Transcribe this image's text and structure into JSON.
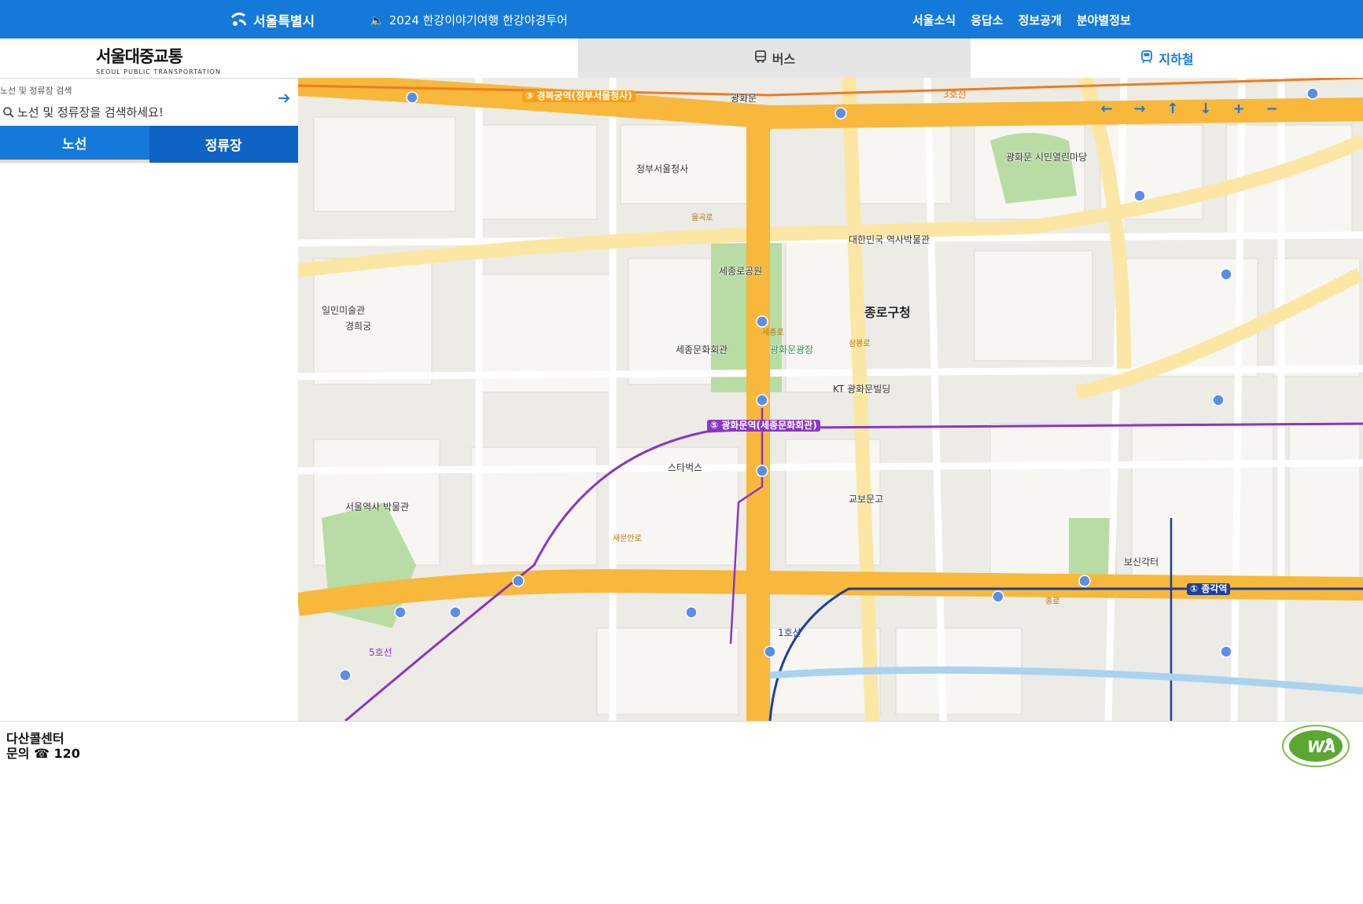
{
  "header": {
    "logo_text": "서울특별시",
    "notice": "2024 한강이야기여행 한강야경투어",
    "nav": [
      "서울소식",
      "응답소",
      "정보공개",
      "분야별정보"
    ]
  },
  "brand": {
    "title": "서울대중교통",
    "subtitle": "SEOUL PUBLIC TRANSPORTATION"
  },
  "mode_tabs": {
    "bus": "버스",
    "subway": "지하철"
  },
  "search": {
    "label": "노선 및 정류장 검색",
    "placeholder": "노선 및 정류장을 검색하세요!"
  },
  "sub_tabs": {
    "route": "노선",
    "stop": "정류장"
  },
  "map": {
    "labels": {
      "gwanghwamun": "광화문",
      "sejong_center": "세종문화회관",
      "jongno_office": "종로구청",
      "gyeongbokgung_stn": "③ 경복궁역(정부서울청사)",
      "gwanghwamun_stn": "⑤ 광화문역(세종문화회관)",
      "jonggak_stn": "① 종각역",
      "sejong_park": "세종로공원",
      "gwanghwamun_square": "광화문광장",
      "museum": "대한민국 역사박물관",
      "kt": "KT 광화문빌딩",
      "kyobo": "교보문고",
      "sejongno": "세종로",
      "saemunan": "새문안로",
      "samilro": "삼봉로",
      "gyeonghuigung": "경희궁",
      "seoul_museum": "서울역사 박물관",
      "starbucks": "스타벅스",
      "ilmin": "일민미술관",
      "bosingak": "보신각터",
      "citizen_yard": "광화문 시민열린마당",
      "jeongbu": "정부서울청사",
      "yulgok": "율곡로",
      "jongno": "종로",
      "line5": "5호선",
      "line3": "3호선",
      "line1": "1호선"
    }
  },
  "footer": {
    "dasan_title": "다산콜센터",
    "dasan_phone": "문의 ☎ 120",
    "wa_mark": "WA"
  },
  "colors": {
    "primary": "#1479d9",
    "primary_dark": "#0f63c4",
    "road": "#f7b83c",
    "line5": "#8a36c4",
    "line1": "#1f3f9c",
    "line3": "#ef7c1c",
    "park": "#b9dca4"
  }
}
